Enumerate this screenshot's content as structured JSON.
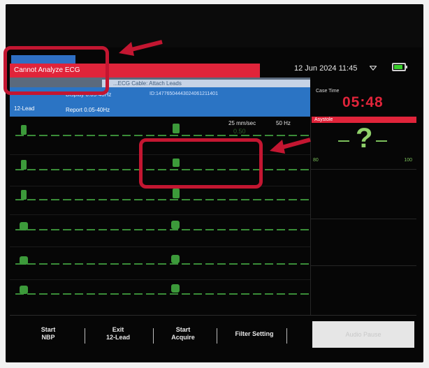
{
  "status": {
    "datetime": "12 Jun 2024 11:45",
    "wifi_icon": "wifi-icon",
    "battery_icon": "battery-icon"
  },
  "alarm": {
    "message": "Cannot Analyze ECG",
    "color": "#e0243a"
  },
  "advisory": {
    "text": "...ECG Cable: Attach Leads"
  },
  "info": {
    "mode_label": "12-Lead",
    "filter_top": "Display 0.05-40Hz",
    "filter_bottom": "Report 0.05-40Hz",
    "patient_id": "ID:14776504443024061211401"
  },
  "case_time": {
    "label": "Case Time",
    "value": "05:48"
  },
  "ecg": {
    "speed": "25 mm/sec",
    "frequency": "50 Hz",
    "lead_color": "#3c9a3a"
  },
  "spo2": {
    "alarm_label": "Asystole",
    "value": "?",
    "low_limit": "80",
    "high_limit": "100",
    "value_color": "#8fd16a"
  },
  "softkeys": [
    {
      "line1": "Start",
      "line2": "NBP"
    },
    {
      "line1": "Exit",
      "line2": "12-Lead"
    },
    {
      "line1": "Start",
      "line2": "Acquire"
    },
    {
      "line1": "Filter Setting",
      "line2": ""
    },
    {
      "line1": "Audio Pause",
      "line2": ""
    }
  ],
  "annotation_color": "#c31631"
}
